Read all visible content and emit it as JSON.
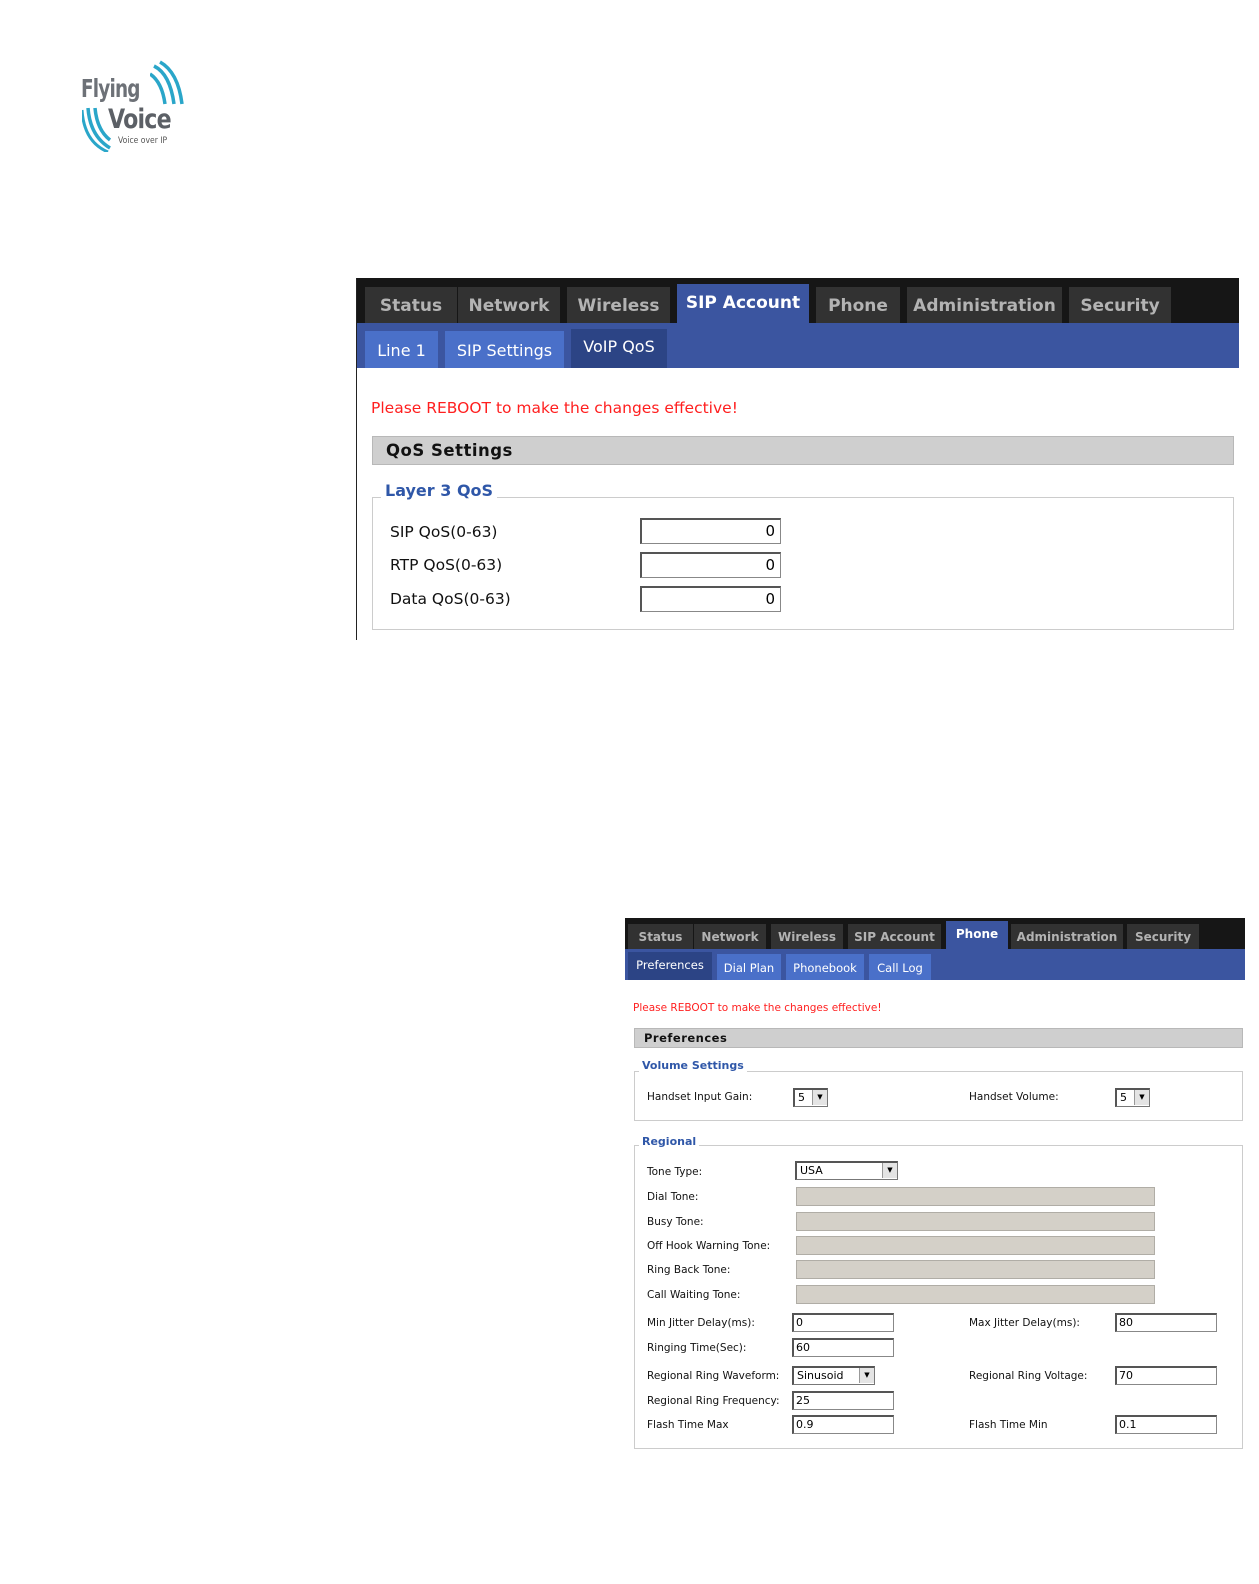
{
  "logo": {
    "line1": "Flying",
    "line2": "Voice",
    "tagline": "Voice over IP"
  },
  "qos_panel": {
    "tabs": [
      "Status",
      "Network",
      "Wireless",
      "SIP Account",
      "Phone",
      "Administration",
      "Security"
    ],
    "active_tab": "SIP Account",
    "subtabs": [
      "Line 1",
      "SIP Settings",
      "VoIP QoS"
    ],
    "active_subtab": "VoIP QoS",
    "warning": "Please REBOOT to make the changes effective!",
    "section_title": "QoS Settings",
    "fieldset_legend": "Layer 3 QoS",
    "fields": [
      {
        "label": "SIP QoS(0-63)",
        "value": "0"
      },
      {
        "label": "RTP QoS(0-63)",
        "value": "0"
      },
      {
        "label": "Data QoS(0-63)",
        "value": "0"
      }
    ]
  },
  "phone_panel": {
    "tabs": [
      "Status",
      "Network",
      "Wireless",
      "SIP Account",
      "Phone",
      "Administration",
      "Security"
    ],
    "active_tab": "Phone",
    "subtabs": [
      "Preferences",
      "Dial Plan",
      "Phonebook",
      "Call Log"
    ],
    "active_subtab": "Preferences",
    "warning": "Please REBOOT to make the changes effective!",
    "section_title": "Preferences",
    "volume": {
      "legend": "Volume Settings",
      "handset_input_gain_label": "Handset Input Gain:",
      "handset_input_gain_value": "5",
      "handset_volume_label": "Handset Volume:",
      "handset_volume_value": "5"
    },
    "regional": {
      "legend": "Regional",
      "tone_type_label": "Tone Type:",
      "tone_type_value": "USA",
      "dial_tone_label": "Dial Tone:",
      "busy_tone_label": "Busy Tone:",
      "off_hook_label": "Off Hook Warning Tone:",
      "ring_back_label": "Ring Back Tone:",
      "call_waiting_label": "Call Waiting Tone:",
      "min_jitter_label": "Min Jitter Delay(ms):",
      "min_jitter_value": "0",
      "max_jitter_label": "Max Jitter Delay(ms):",
      "max_jitter_value": "80",
      "ringing_time_label": "Ringing Time(Sec):",
      "ringing_time_value": "60",
      "ring_waveform_label": "Regional Ring Waveform:",
      "ring_waveform_value": "Sinusoid",
      "ring_voltage_label": "Regional Ring Voltage:",
      "ring_voltage_value": "70",
      "ring_frequency_label": "Regional Ring Frequency:",
      "ring_frequency_value": "25",
      "flash_max_label": "Flash Time Max",
      "flash_max_value": "0.9",
      "flash_min_label": "Flash Time Min",
      "flash_min_value": "0.1"
    }
  },
  "colors": {
    "tab_bar": "#161616",
    "tab_inactive": "#323232",
    "tab_active": "#3b55a0",
    "subtab": "#4a70c9",
    "subtab_active": "#2c4485",
    "warning": "#ff1f1f",
    "legend": "#2f57a8"
  }
}
